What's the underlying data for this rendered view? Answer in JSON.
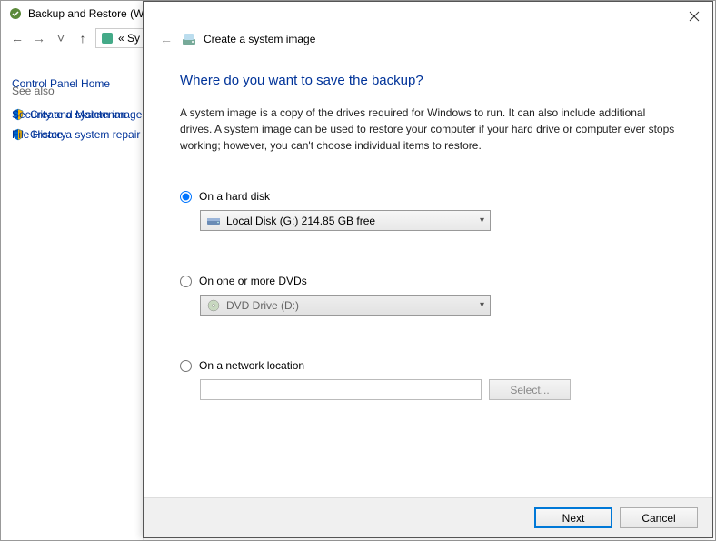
{
  "controlPanel": {
    "title": "Backup and Restore (Wi",
    "breadcrumbPrefix": "« Sy",
    "sidebar": {
      "home": "Control Panel Home",
      "createImage": "Create a system image",
      "createRepair": "Create a system repair d",
      "seeAlso": "See also",
      "securityMaintenance": "Security and Maintenan",
      "fileHistory": "File History"
    }
  },
  "dialog": {
    "headerTitle": "Create a system image",
    "heading": "Where do you want to save the backup?",
    "description": "A system image is a copy of the drives required for Windows to run. It can also include additional drives. A system image can be used to restore your computer if your hard drive or computer ever stops working; however, you can't choose individual items to restore.",
    "options": {
      "hardDisk": {
        "label": "On a hard disk",
        "selected": "Local Disk (G:)  214.85 GB free",
        "checked": true
      },
      "dvd": {
        "label": "On one or more DVDs",
        "selected": "DVD Drive (D:)",
        "checked": false
      },
      "network": {
        "label": "On a network location",
        "value": "",
        "selectButton": "Select...",
        "checked": false
      }
    },
    "buttons": {
      "next": "Next",
      "cancel": "Cancel"
    }
  }
}
